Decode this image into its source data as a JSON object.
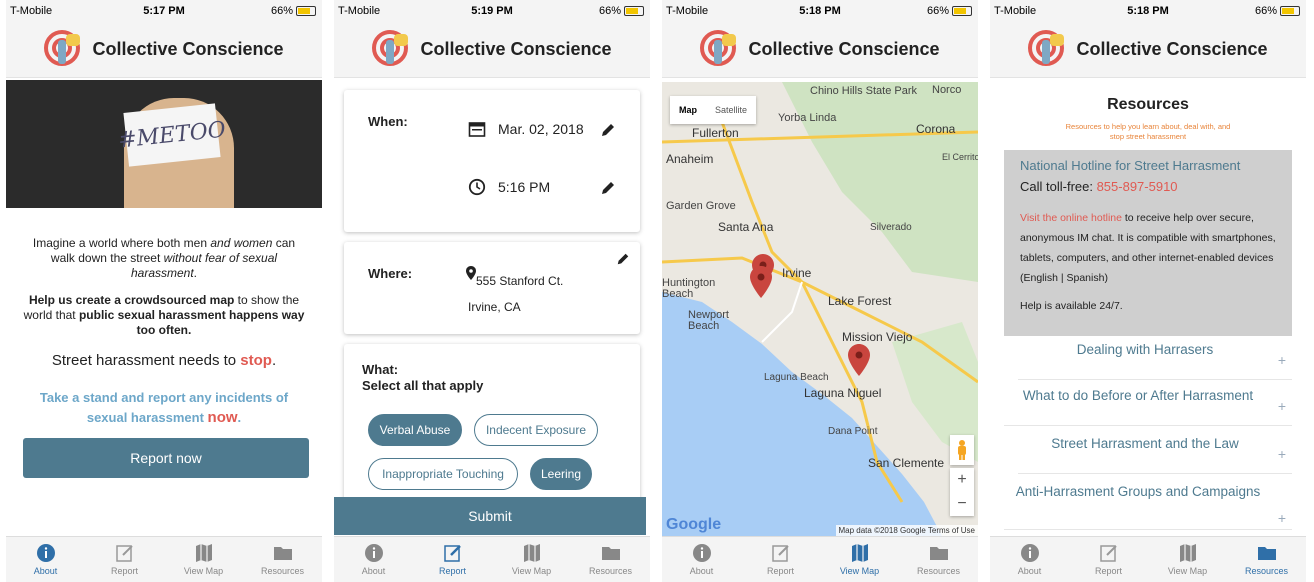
{
  "status": {
    "carrier": "T-Mobile",
    "battery": "66%",
    "times": [
      "5:17 PM",
      "5:19 PM",
      "5:18 PM",
      "5:18 PM"
    ]
  },
  "app": {
    "title": "Collective Conscience"
  },
  "tabs": [
    {
      "label": "About",
      "icon": "info-icon"
    },
    {
      "label": "Report",
      "icon": "compose-icon"
    },
    {
      "label": "View Map",
      "icon": "map-icon"
    },
    {
      "label": "Resources",
      "icon": "folder-icon"
    }
  ],
  "about": {
    "hero_sign": "#METOO",
    "p1_a": "Imagine a world where both men ",
    "p1_b": "and women",
    "p1_c": " can walk down the street ",
    "p1_d": "without fear of sexual harassment",
    "p1_e": ".",
    "p2_a": "Help us create a crowdsourced map",
    "p2_b": " to show the world that ",
    "p2_c": "public sexual harassment happens way too often.",
    "stop_a": "Street harassment needs to ",
    "stop_b": "stop",
    "stop_c": ".",
    "cta_a": "Take a stand and report any incidents of sexual harassment ",
    "cta_b": "now",
    "cta_c": ".",
    "button": "Report now"
  },
  "report": {
    "when_label": "When:",
    "date": "Mar. 02, 2018",
    "time": "5:16 PM",
    "where_label": "Where:",
    "address1": "555 Stanford Ct.",
    "address2": "Irvine, CA",
    "what_label": "What:",
    "what_hint": "Select all that apply",
    "chips": [
      {
        "label": "Verbal Abuse",
        "selected": true
      },
      {
        "label": "Indecent Exposure",
        "selected": false
      },
      {
        "label": "Inappropriate Touching",
        "selected": false
      },
      {
        "label": "Leering",
        "selected": true
      }
    ],
    "submit": "Submit"
  },
  "map": {
    "type_map": "Map",
    "type_satellite": "Satellite",
    "labels": [
      "Chino Hills State Park",
      "Yorba Linda",
      "Norco",
      "Fullerton",
      "Corona",
      "Anaheim",
      "El Cerrito",
      "Garden Grove",
      "Santa Ana",
      "Silverado",
      "Irvine",
      "Huntington Beach",
      "Lake Forest",
      "Newport Beach",
      "Mission Viejo",
      "Laguna Beach",
      "Laguna Niguel",
      "Dana Point",
      "San Clemente"
    ],
    "logo": "Google",
    "attribution": "Map data ©2018 Google   Terms of Use"
  },
  "resources": {
    "title": "Resources",
    "subtitle": "Resources to help you learn about, deal with, and stop street harassment",
    "open_title": "National Hotline for Street Harrasment",
    "call_label": "Call toll-free: ",
    "phone": "855-897-5910",
    "link_text": "Visit the online hotline",
    "body_text": " to receive help over secure, anonymous IM chat. It is compatible with smartphones, tablets, computers, and other internet-enabled devices (English | Spanish)",
    "help": "Help is available 24/7.",
    "sections": [
      "Dealing with Harrasers",
      "What to do Before or After Harrasment",
      "Street Harrasment and the Law",
      "Anti-Harrasment Groups and Campaigns"
    ]
  },
  "colors": {
    "accent": "#4e7a8f",
    "red": "#e05a52",
    "light_blue": "#6da7c9",
    "tab_active": "#2f6fa8"
  }
}
